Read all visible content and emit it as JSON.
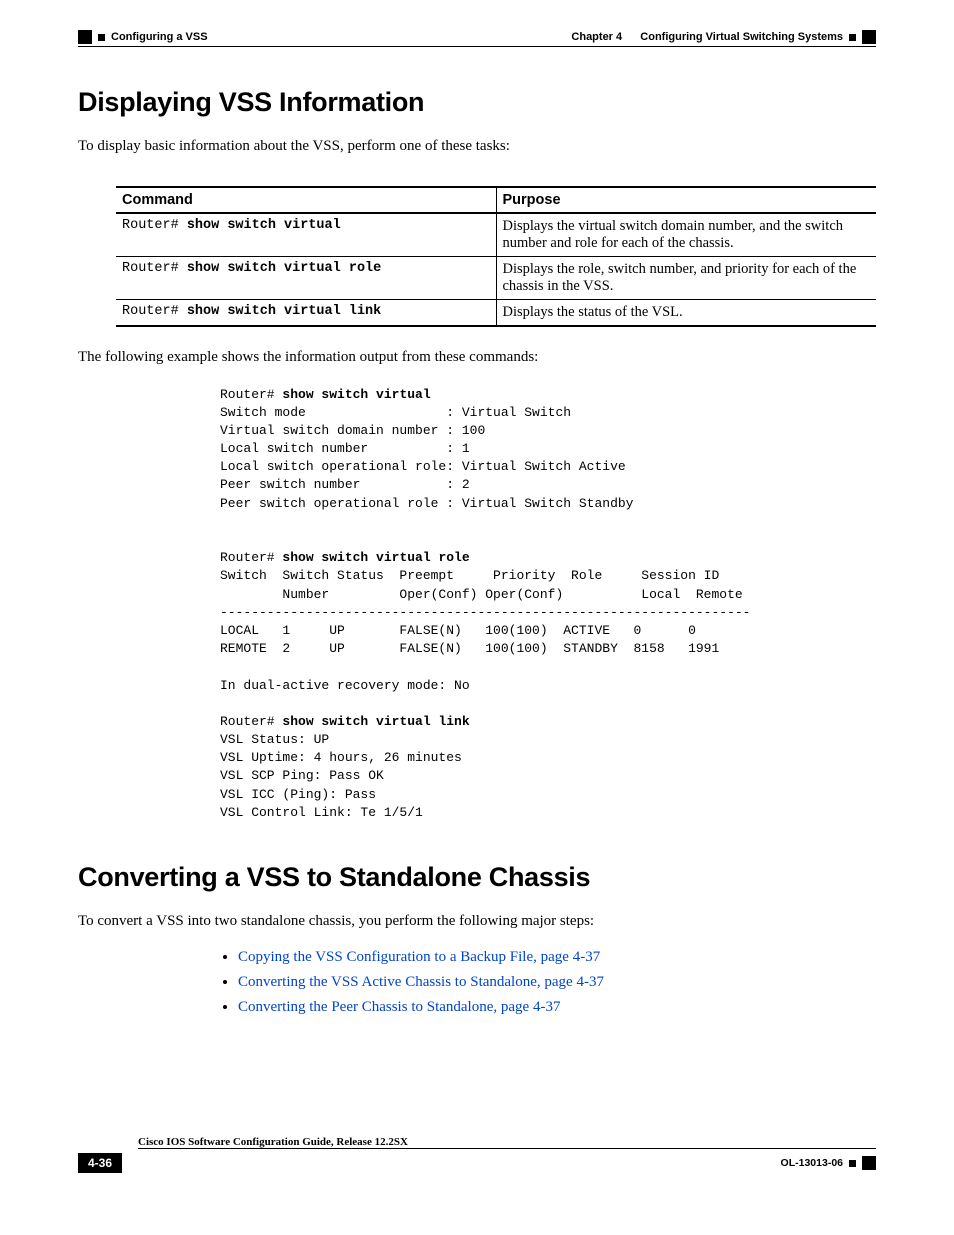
{
  "header": {
    "section": "Configuring a VSS",
    "chapter_label": "Chapter 4",
    "chapter_title": "Configuring Virtual Switching Systems"
  },
  "h1_a": "Displaying VSS Information",
  "intro_a": "To display basic information about the VSS, perform one of these tasks:",
  "table": {
    "head_cmd": "Command",
    "head_purpose": "Purpose",
    "rows": [
      {
        "prompt": "Router# ",
        "cmd": "show switch virtual",
        "purpose": "Displays the virtual switch domain number, and the switch number and role for each of the chassis."
      },
      {
        "prompt": "Router# ",
        "cmd": "show switch virtual role",
        "purpose": "Displays the role, switch number, and priority for each of the chassis in the VSS."
      },
      {
        "prompt": "Router# ",
        "cmd": "show switch virtual link",
        "purpose": "Displays the status of the VSL."
      }
    ]
  },
  "example_intro": "The following example shows the information output from these commands:",
  "out1_prompt": "Router# ",
  "out1_cmd": "show switch virtual",
  "out1_body": "Switch mode                  : Virtual Switch\nVirtual switch domain number : 100\nLocal switch number          : 1\nLocal switch operational role: Virtual Switch Active\nPeer switch number           : 2\nPeer switch operational role : Virtual Switch Standby",
  "out2_prompt": "Router# ",
  "out2_cmd": "show switch virtual role",
  "out2_body": "Switch  Switch Status  Preempt     Priority  Role     Session ID\n        Number         Oper(Conf) Oper(Conf)          Local  Remote\n--------------------------------------------------------------------\nLOCAL   1     UP       FALSE(N)   100(100)  ACTIVE   0      0\nREMOTE  2     UP       FALSE(N)   100(100)  STANDBY  8158   1991\n\nIn dual-active recovery mode: No",
  "out3_prompt": "Router# ",
  "out3_cmd": "show switch virtual link",
  "out3_body": "VSL Status: UP\nVSL Uptime: 4 hours, 26 minutes\nVSL SCP Ping: Pass OK\nVSL ICC (Ping): Pass\nVSL Control Link: Te 1/5/1",
  "h1_b": "Converting a VSS to Standalone Chassis",
  "intro_b": "To convert a VSS into two standalone chassis, you perform the following major steps:",
  "links": [
    "Copying the VSS Configuration to a Backup File, page 4-37",
    "Converting the VSS Active Chassis to Standalone, page 4-37",
    "Converting the Peer Chassis to Standalone, page 4-37"
  ],
  "footer": {
    "guide": "Cisco IOS Software Configuration Guide, Release 12.2SX",
    "page": "4-36",
    "doc_id": "OL-13013-06"
  }
}
